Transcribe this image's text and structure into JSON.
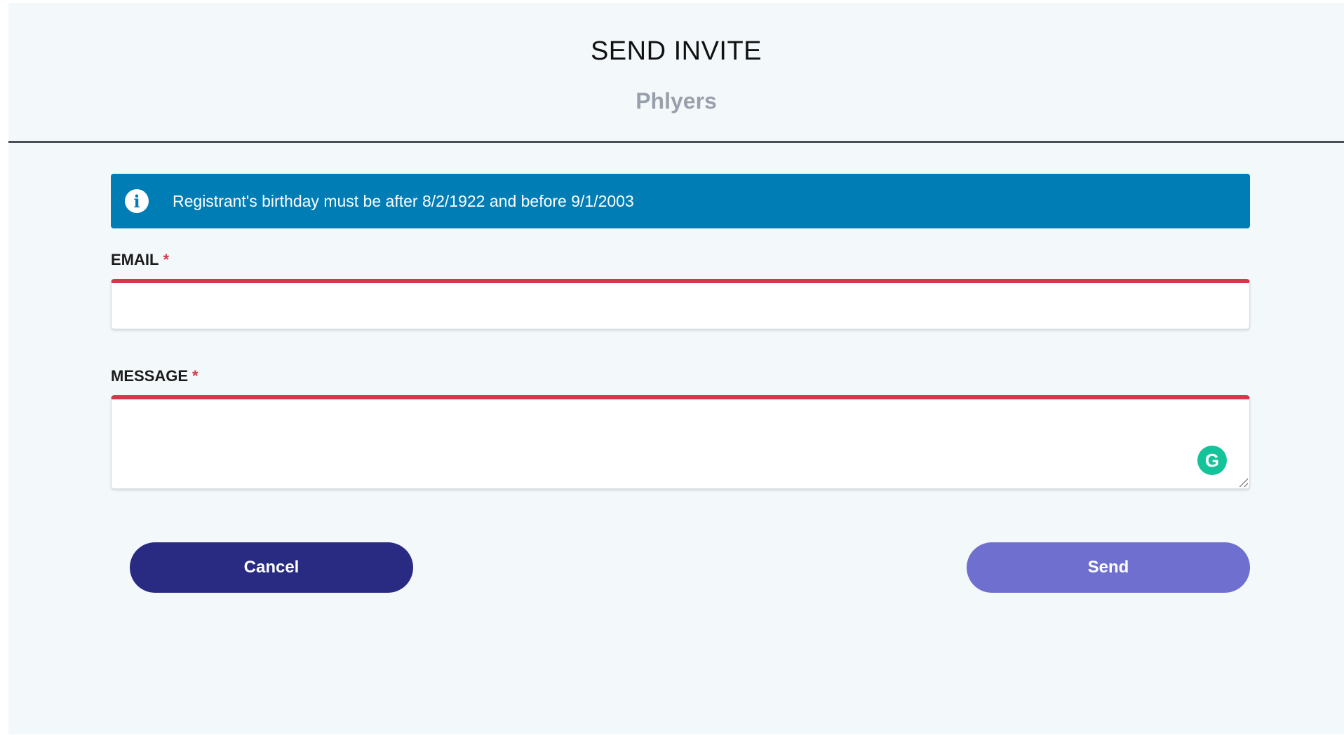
{
  "header": {
    "title": "SEND INVITE",
    "subtitle": "Phlyers"
  },
  "info_banner": {
    "icon": "info-icon",
    "icon_glyph": "i",
    "text": "Registrant's birthday must be after 8/2/1922 and before 9/1/2003"
  },
  "form": {
    "email": {
      "label": "EMAIL",
      "required_marker": "*",
      "value": "",
      "placeholder": ""
    },
    "message": {
      "label": "MESSAGE",
      "required_marker": "*",
      "value": "",
      "placeholder": ""
    }
  },
  "extension": {
    "icon": "grammarly-icon",
    "glyph": "G"
  },
  "actions": {
    "cancel_label": "Cancel",
    "send_label": "Send"
  },
  "colors": {
    "banner": "#007db4",
    "error": "#d8364b",
    "cancel_button": "#292a82",
    "send_button": "#6f6fcf",
    "background": "#f3f8fb"
  }
}
